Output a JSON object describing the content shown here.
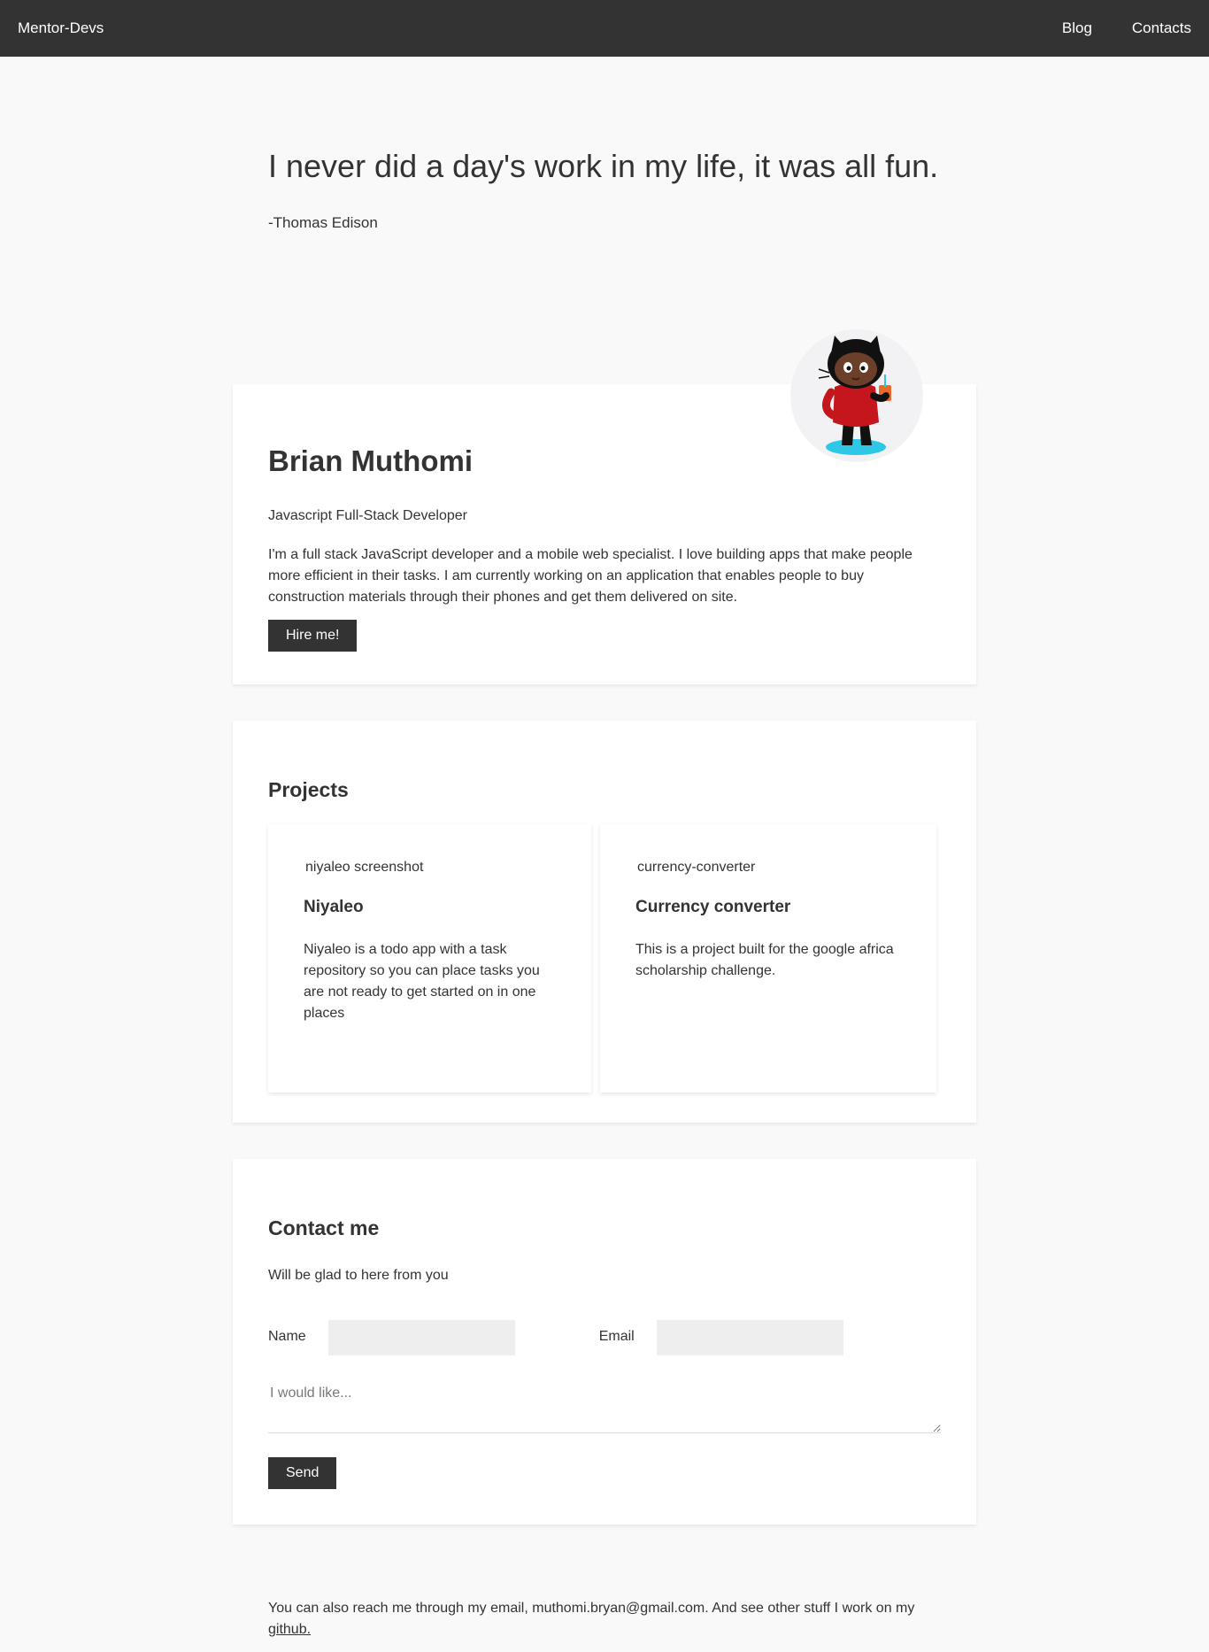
{
  "nav": {
    "brand": "Mentor-Devs",
    "links": [
      "Blog",
      "Contacts"
    ]
  },
  "quote": {
    "text": "I never did a day's work in my life, it was all fun.",
    "author": "-Thomas Edison"
  },
  "profile": {
    "name": "Brian Muthomi",
    "role": "Javascript Full-Stack Developer",
    "bio": "I'm a full stack JavaScript developer and a mobile web specialist. I love building apps that make people more efficient in their tasks. I am currently working on an application that enables people to buy construction materials through their phones and get them delivered on site.",
    "hire_label": "Hire me!",
    "avatar_icon": "octocat-icon"
  },
  "projects": {
    "title": "Projects",
    "items": [
      {
        "img_alt": "niyaleo screenshot",
        "title": "Niyaleo",
        "desc": "Niyaleo is a todo app with a task repository so you can place tasks you are not ready to get started on in one places"
      },
      {
        "img_alt": "currency-converter",
        "title": "Currency converter",
        "desc": "This is a project built for the google africa scholarship challenge."
      }
    ]
  },
  "contact": {
    "title": "Contact me",
    "subtitle": "Will be glad to here from you",
    "name_label": "Name",
    "email_label": "Email",
    "message_placeholder": "I would like...",
    "send_label": "Send"
  },
  "footer": {
    "text": "You can also reach me through my email, muthomi.bryan@gmail.com. And see other stuff I work on my",
    "link_text": "github."
  },
  "colors": {
    "navbar": "#333333",
    "background": "#f9f9f9",
    "card": "#ffffff",
    "button": "#333333",
    "input": "#eeeeee"
  }
}
